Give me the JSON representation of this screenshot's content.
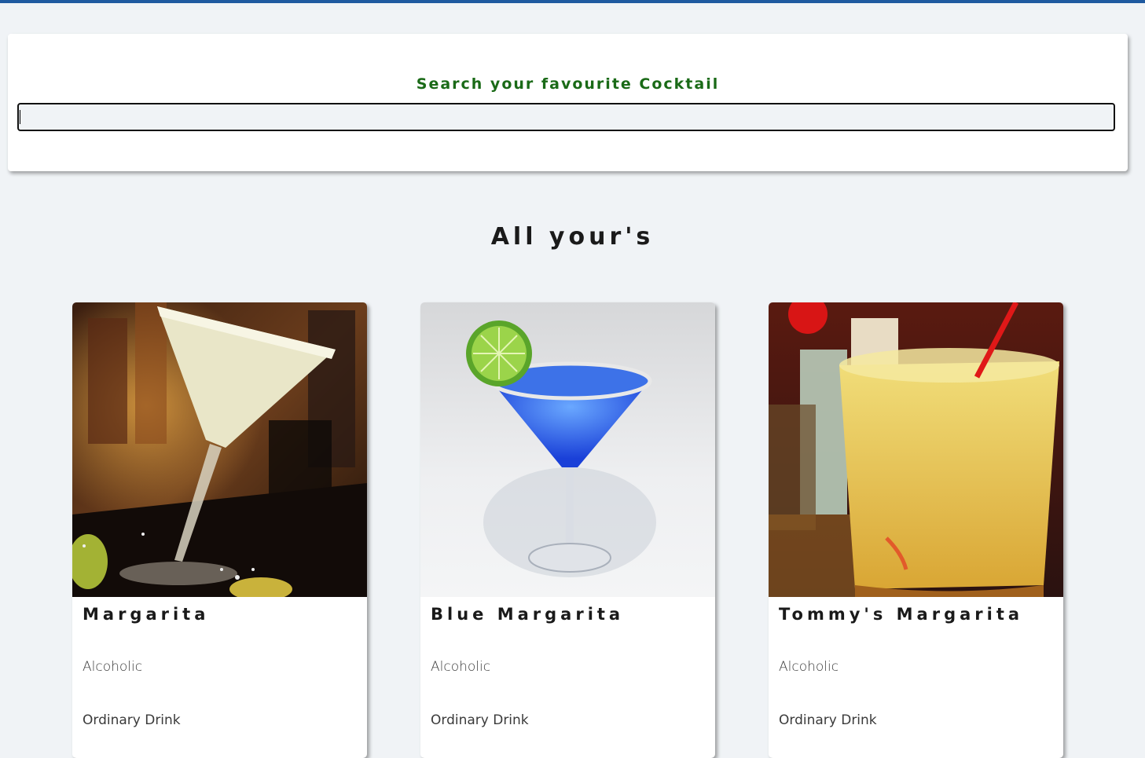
{
  "search": {
    "label": "Search your favourite Cocktail",
    "value": "",
    "placeholder": ""
  },
  "section": {
    "title": "All your's"
  },
  "cocktails": [
    {
      "name": "Margarita",
      "alcoholic": "Alcoholic",
      "category": "Ordinary Drink"
    },
    {
      "name": "Blue Margarita",
      "alcoholic": "Alcoholic",
      "category": "Ordinary Drink"
    },
    {
      "name": "Tommy's Margarita",
      "alcoholic": "Alcoholic",
      "category": "Ordinary Drink"
    }
  ],
  "colors": {
    "accent_bar": "#1f5aa0",
    "search_label": "#1a6a17",
    "background": "#f0f3f6"
  }
}
